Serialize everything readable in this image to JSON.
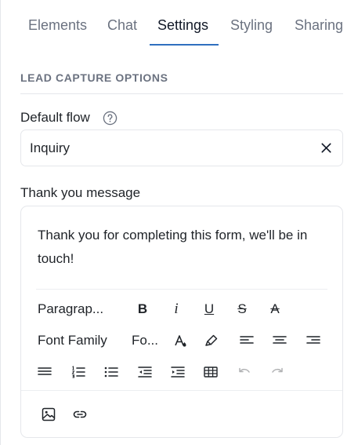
{
  "tabs": [
    {
      "label": "Elements"
    },
    {
      "label": "Chat"
    },
    {
      "label": "Settings"
    },
    {
      "label": "Styling"
    },
    {
      "label": "Sharing"
    }
  ],
  "active_tab": "Settings",
  "section": {
    "title": "LEAD CAPTURE OPTIONS"
  },
  "default_flow": {
    "label": "Default flow",
    "value": "Inquiry"
  },
  "thank_you": {
    "label": "Thank you message",
    "text": "Thank you for completing this form, we'll be in touch!"
  },
  "toolbar": {
    "paragraph": "Paragrap...",
    "bold": "B",
    "italic": "i",
    "underline": "U",
    "strikethrough": "S",
    "clear_format": "A",
    "font_family": "Font Family",
    "font_size": "Fo..."
  },
  "colors": {
    "accent": "#2f6fbf",
    "border": "#e5e7eb",
    "muted": "#6b7280"
  }
}
